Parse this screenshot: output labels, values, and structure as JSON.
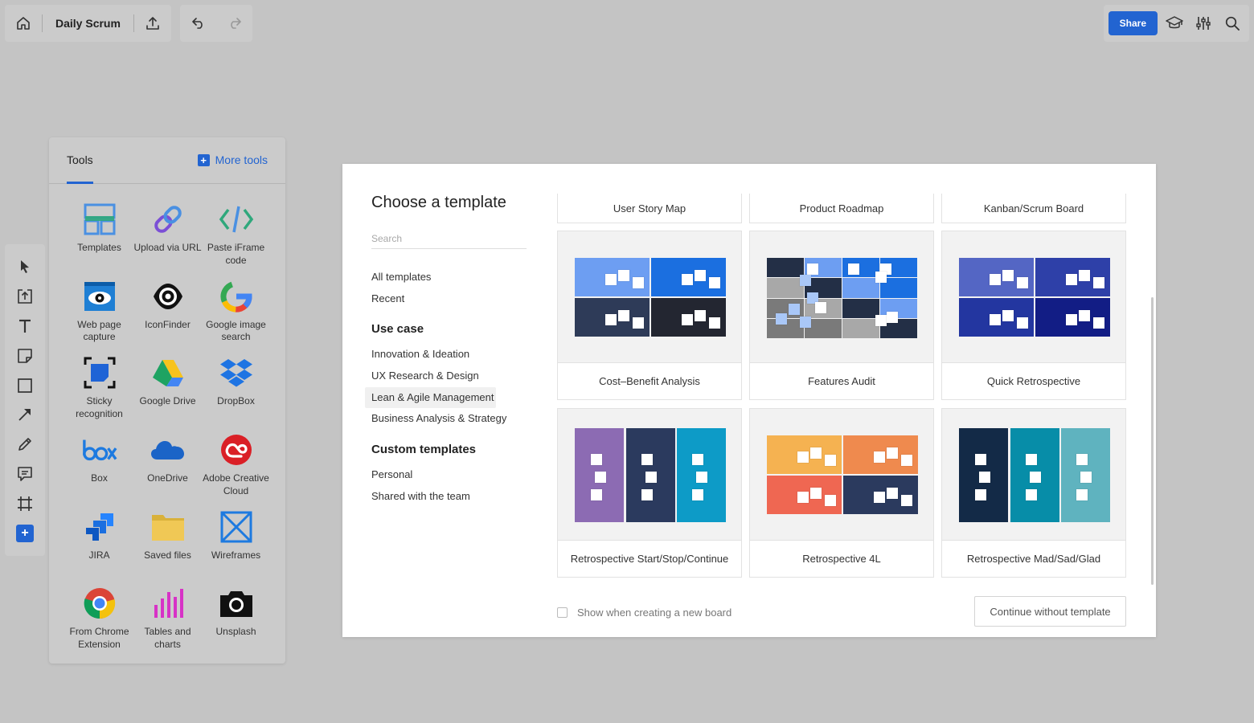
{
  "topbar": {
    "board_title": "Daily Scrum",
    "share_label": "Share",
    "icons": [
      "home-icon",
      "upload-icon",
      "undo-icon",
      "redo-icon",
      "learn-icon",
      "settings-sliders-icon",
      "search-icon"
    ]
  },
  "tools_panel": {
    "tab_label": "Tools",
    "more_tools_label": "More tools",
    "tools": [
      {
        "label": "Templates",
        "icon": "templates-icon"
      },
      {
        "label": "Upload via URL",
        "icon": "link-icon"
      },
      {
        "label": "Paste iFrame code",
        "icon": "code-icon"
      },
      {
        "label": "Web page capture",
        "icon": "eye-icon"
      },
      {
        "label": "IconFinder",
        "icon": "iconfinder-icon"
      },
      {
        "label": "Google image search",
        "icon": "google-icon"
      },
      {
        "label": "Sticky recognition",
        "icon": "sticky-recognition-icon"
      },
      {
        "label": "Google Drive",
        "icon": "google-drive-icon"
      },
      {
        "label": "DropBox",
        "icon": "dropbox-icon"
      },
      {
        "label": "Box",
        "icon": "box-icon"
      },
      {
        "label": "OneDrive",
        "icon": "onedrive-icon"
      },
      {
        "label": "Adobe Creative Cloud",
        "icon": "adobe-cc-icon"
      },
      {
        "label": "JIRA",
        "icon": "jira-icon"
      },
      {
        "label": "Saved files",
        "icon": "folder-icon"
      },
      {
        "label": "Wireframes",
        "icon": "wireframes-icon"
      },
      {
        "label": "From Chrome Extension",
        "icon": "chrome-icon"
      },
      {
        "label": "Tables and charts",
        "icon": "bar-chart-icon"
      },
      {
        "label": "Unsplash",
        "icon": "camera-icon"
      }
    ]
  },
  "left_toolbar": {
    "icons": [
      "cursor-icon",
      "upload-frame-icon",
      "text-icon",
      "sticky-note-icon",
      "shape-icon",
      "arrow-icon",
      "pen-icon",
      "comment-icon",
      "frame-icon",
      "add-icon"
    ]
  },
  "modal": {
    "title": "Choose a template",
    "search_placeholder": "Search",
    "nav": {
      "all_templates": "All templates",
      "recent": "Recent",
      "use_case_heading": "Use case",
      "use_cases": [
        "Innovation & Ideation",
        "UX Research & Design",
        "Lean & Agile Management",
        "Business Analysis & Strategy"
      ],
      "selected_use_case": "Lean & Agile Management",
      "custom_heading": "Custom templates",
      "custom": [
        "Personal",
        "Shared with the team"
      ]
    },
    "top_row": [
      "User Story Map",
      "Product Roadmap",
      "Kanban/Scrum Board"
    ],
    "templates": [
      {
        "label": "Cost–Benefit Analysis"
      },
      {
        "label": "Features Audit"
      },
      {
        "label": "Quick Retrospective"
      },
      {
        "label": "Retrospective Start/Stop/Continue"
      },
      {
        "label": "Retrospective 4L"
      },
      {
        "label": "Retrospective Mad/Sad/Glad"
      }
    ],
    "show_new_board_label": "Show when creating a new board",
    "continue_label": "Continue without template"
  },
  "colors": {
    "accent": "#2264d1",
    "background": "#c4c4c4"
  }
}
